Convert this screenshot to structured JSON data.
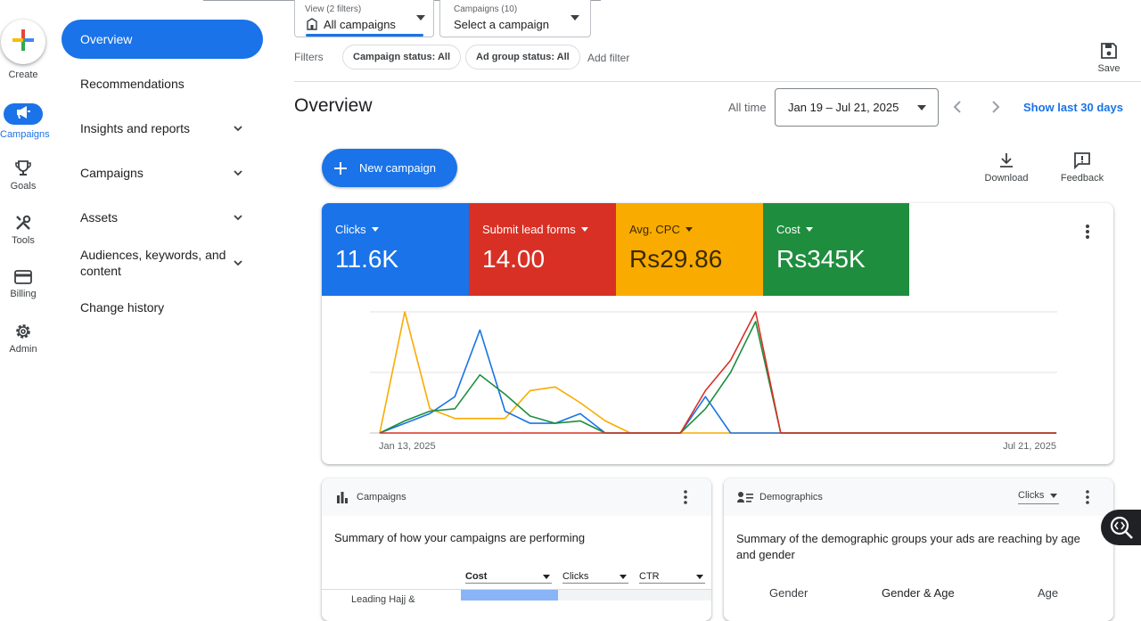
{
  "rail": {
    "create": "Create",
    "campaigns": "Campaigns",
    "goals": "Goals",
    "tools": "Tools",
    "billing": "Billing",
    "admin": "Admin"
  },
  "nav": {
    "overview": "Overview",
    "recommendations": "Recommendations",
    "insights": "Insights and reports",
    "campaigns": "Campaigns",
    "assets": "Assets",
    "audiences_line1": "Audiences, keywords, and",
    "audiences_line2": "content",
    "change_history": "Change history"
  },
  "topbar": {
    "view_label": "View (2 filters)",
    "view_value": "All campaigns",
    "campaigns_label": "Campaigns (10)",
    "campaigns_value": "Select a campaign",
    "filters_label": "Filters",
    "chip_status": "Campaign status: All",
    "chip_adgroup": "Ad group status: All",
    "add_filter": "Add filter",
    "save": "Save"
  },
  "header": {
    "title": "Overview",
    "all_time": "All time",
    "date_range": "Jan 19 – Jul 21, 2025",
    "show_last": "Show last 30 days"
  },
  "actions": {
    "new_campaign": "New campaign",
    "download": "Download",
    "feedback": "Feedback"
  },
  "metrics": [
    {
      "label": "Clicks",
      "value": "11.6K",
      "color": "#1a73e8"
    },
    {
      "label": "Submit lead forms",
      "value": "14.00",
      "color": "#d93025"
    },
    {
      "label": "Avg. CPC",
      "value": "Rs29.86",
      "color": "#f9ab00"
    },
    {
      "label": "Cost",
      "value": "Rs345K",
      "color": "#1e8e3e"
    }
  ],
  "chart_data": {
    "type": "line",
    "x_start_label": "Jan 13, 2025",
    "x_end_label": "Jul 21, 2025",
    "points": 28,
    "ylim": [
      0,
      100
    ],
    "grid": true,
    "series": [
      {
        "color": "#f9ab00",
        "values": [
          0,
          100,
          20,
          12,
          12,
          12,
          35,
          38,
          25,
          10,
          0,
          0,
          0,
          0,
          0,
          0,
          0,
          0,
          0,
          0,
          0,
          0,
          0,
          0,
          0,
          0,
          0,
          0
        ]
      },
      {
        "color": "#1a73e8",
        "values": [
          0,
          8,
          16,
          30,
          85,
          18,
          8,
          8,
          16,
          0,
          0,
          0,
          0,
          30,
          0,
          0,
          0,
          0,
          0,
          0,
          0,
          0,
          0,
          0,
          0,
          0,
          0,
          0
        ]
      },
      {
        "color": "#1e8e3e",
        "values": [
          0,
          10,
          18,
          20,
          48,
          32,
          14,
          8,
          10,
          0,
          0,
          0,
          0,
          20,
          50,
          92,
          0,
          0,
          0,
          0,
          0,
          0,
          0,
          0,
          0,
          0,
          0,
          0
        ]
      },
      {
        "color": "#d93025",
        "values": [
          0,
          0,
          0,
          0,
          0,
          0,
          0,
          0,
          0,
          0,
          0,
          0,
          0,
          35,
          60,
          100,
          0,
          0,
          0,
          0,
          0,
          0,
          0,
          0,
          0,
          0,
          0,
          0
        ]
      }
    ]
  },
  "campaigns_card": {
    "title": "Campaigns",
    "summary": "Summary of how your campaigns are performing",
    "col_cost": "Cost",
    "col_clicks": "Clicks",
    "col_ctr": "CTR",
    "row_label": "Leading Hajj &"
  },
  "demographics_card": {
    "title": "Demographics",
    "metric_select": "Clicks",
    "summary_line1": "Summary of the demographic groups your ads are reaching by age",
    "summary_line2": "and gender",
    "tab_gender": "Gender",
    "tab_gender_age": "Gender & Age",
    "tab_age": "Age"
  }
}
